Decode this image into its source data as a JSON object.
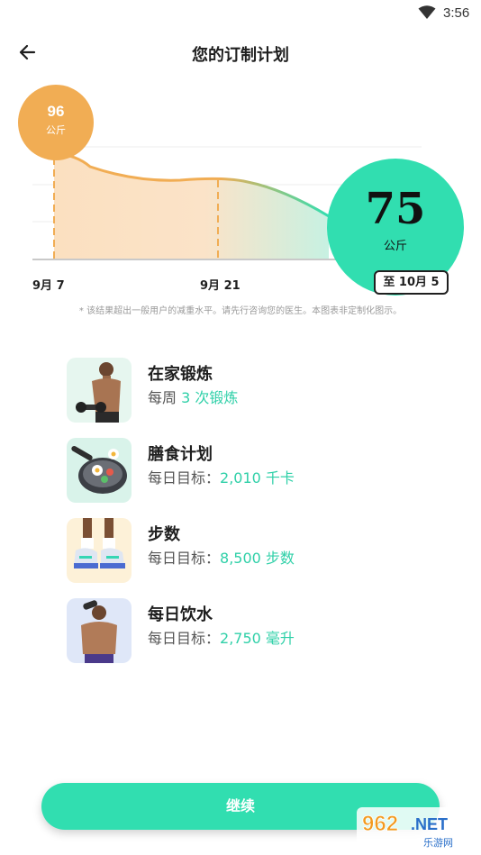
{
  "status_bar": {
    "time": "3:56"
  },
  "header": {
    "title": "您的订制计划"
  },
  "chart_data": {
    "type": "area",
    "start": {
      "value": "96",
      "unit": "公斤"
    },
    "end": {
      "value": "75",
      "unit": "公斤"
    },
    "x_ticks": [
      "9月 7",
      "9月 21",
      "至 10月 5"
    ],
    "y": [
      96,
      88,
      86,
      75
    ]
  },
  "disclaimer": "* 该结果超出一般用户的减重水平。请先行咨询您的医生。本图表非定制化图示。",
  "plans": [
    {
      "title": "在家锻炼",
      "prefix": "每周 ",
      "highlight": "3 次锻炼",
      "icon": "dumbbell-man-photo"
    },
    {
      "title": "膳食计划",
      "prefix": "每日目标：",
      "highlight": "2,010 千卡",
      "icon": "pan-food-photo"
    },
    {
      "title": "步数",
      "prefix": "每日目标：",
      "highlight": "8,500 步数",
      "icon": "sneakers-photo"
    },
    {
      "title": "每日饮水",
      "prefix": "每日目标：",
      "highlight": "2,750 毫升",
      "icon": "drinking-man-photo"
    }
  ],
  "continue_button": {
    "label": "继续"
  },
  "watermark": {
    "brand": "962",
    "suffix": ".NET",
    "sub": "乐游网"
  },
  "colors": {
    "accent": "#31deb0",
    "orange": "#f1ad54"
  }
}
